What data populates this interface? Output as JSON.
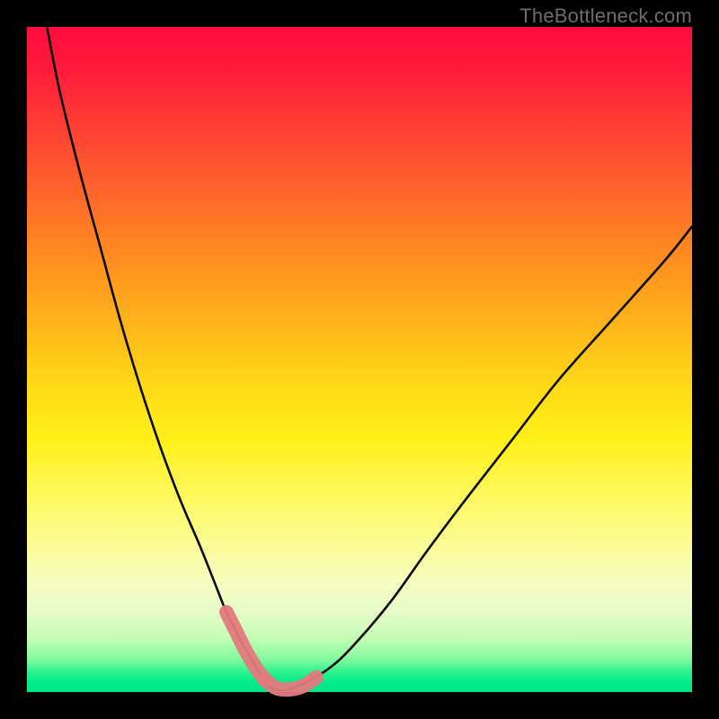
{
  "watermark": "TheBottleneck.com",
  "chart_data": {
    "type": "line",
    "title": "",
    "xlabel": "",
    "ylabel": "",
    "xlim": [
      0,
      100
    ],
    "ylim": [
      0,
      100
    ],
    "series": [
      {
        "name": "bottleneck-curve",
        "x": [
          3,
          5,
          8,
          11,
          14,
          17,
          20,
          23,
          26,
          28,
          30,
          32,
          34,
          35.5,
          37,
          39,
          42,
          46,
          50,
          55,
          60,
          66,
          73,
          80,
          88,
          96,
          100
        ],
        "y": [
          100,
          90,
          78,
          67,
          56,
          46,
          37,
          29,
          22,
          17,
          12,
          8,
          4.5,
          2,
          0.5,
          0.3,
          1.5,
          4,
          8,
          14,
          21,
          29,
          38,
          47,
          56,
          65,
          70
        ]
      }
    ],
    "highlight_segments": [
      {
        "name": "left-thick",
        "x": [
          30,
          31.5,
          33,
          34.5,
          35.8
        ],
        "y": [
          12,
          9,
          6,
          3.5,
          1.8
        ]
      },
      {
        "name": "bottom-thick",
        "x": [
          35.8,
          37.5,
          39.5,
          41.5,
          43.5
        ],
        "y": [
          1.8,
          0.6,
          0.4,
          0.9,
          2.2
        ]
      }
    ],
    "background_gradient": {
      "top": "#ff0b3f",
      "middle": "#fff018",
      "bottom": "#00e688"
    }
  }
}
